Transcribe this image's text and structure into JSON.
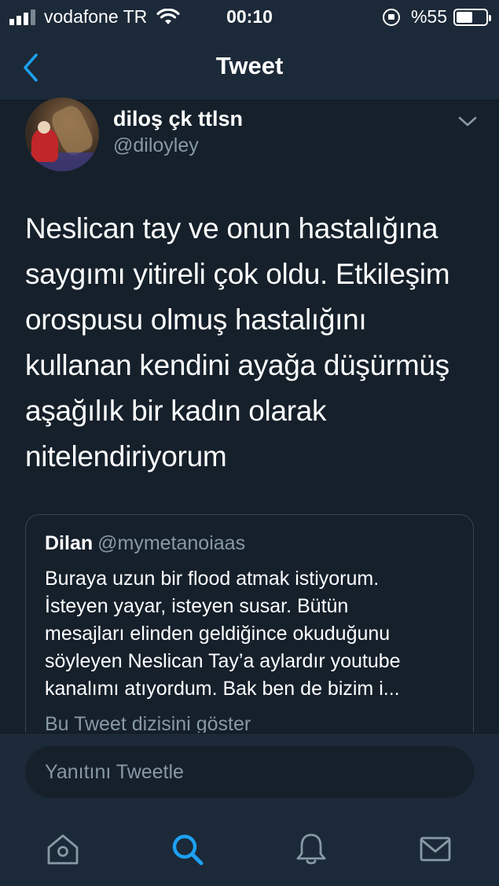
{
  "status_bar": {
    "carrier": "vodafone TR",
    "time": "00:10",
    "battery_percent": "%55",
    "battery_level": 0.55
  },
  "nav": {
    "title": "Tweet",
    "back_icon": "chevron-left-icon"
  },
  "tweet": {
    "display_name": "diloş çk ttlsn",
    "handle": "@diloyley",
    "text_lines": [
      "Neslican tay ve onun hastalığına",
      "saygımı yitireli çok oldu. Etkileşim",
      "orospusu olmuş hastalığını",
      "kullanan kendini ayağa düşürmüş",
      "aşağılık bir kadın olarak",
      "nitelendiriyorum"
    ],
    "menu_icon": "chevron-down-icon"
  },
  "quoted_tweet": {
    "name": "Dilan",
    "handle": "@mymetanoiaas",
    "text_lines": [
      "Buraya uzun bir flood atmak istiyorum.",
      "İsteyen yayar, isteyen susar. Bütün",
      "mesajları elinden geldiğince okuduğunu",
      "söyleyen Neslican Tay’a aylardır youtube",
      "kanalımı atıyordum. Bak ben de bizim i..."
    ],
    "show_thread": "Bu Tweet dizisini göster"
  },
  "reply": {
    "placeholder": "Yanıtını Tweetle"
  },
  "tabs": [
    {
      "name": "home",
      "icon": "home-icon",
      "active": false
    },
    {
      "name": "search",
      "icon": "search-icon",
      "active": true
    },
    {
      "name": "notifications",
      "icon": "bell-icon",
      "active": false
    },
    {
      "name": "messages",
      "icon": "envelope-icon",
      "active": false
    }
  ],
  "colors": {
    "background": "#15202b",
    "bar": "#1c2938",
    "accent": "#1da1f2",
    "secondary_text": "#8899a6",
    "icon_inactive": "#8899a6"
  }
}
